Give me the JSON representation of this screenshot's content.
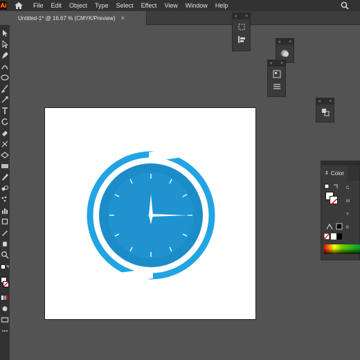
{
  "app": {
    "logo": "Ai"
  },
  "menu": {
    "items": [
      "File",
      "Edit",
      "Object",
      "Type",
      "Select",
      "Effect",
      "View",
      "Window",
      "Help"
    ]
  },
  "document": {
    "tab_title": "Untitled-1* @ 16.67 % (CMYK/Preview)",
    "close_glyph": "×"
  },
  "panels": {
    "color": {
      "title": "Color",
      "channels": [
        "C",
        "M",
        "Y",
        "K"
      ]
    },
    "collapse_glyph": "«",
    "close_glyph": "×"
  },
  "icons": {
    "home": "home-icon",
    "search": "search-icon"
  },
  "colors": {
    "ring": "#21a4e3",
    "face": "#1b8cc8",
    "ticks": "#ffffff",
    "hands": "#ffffff"
  }
}
